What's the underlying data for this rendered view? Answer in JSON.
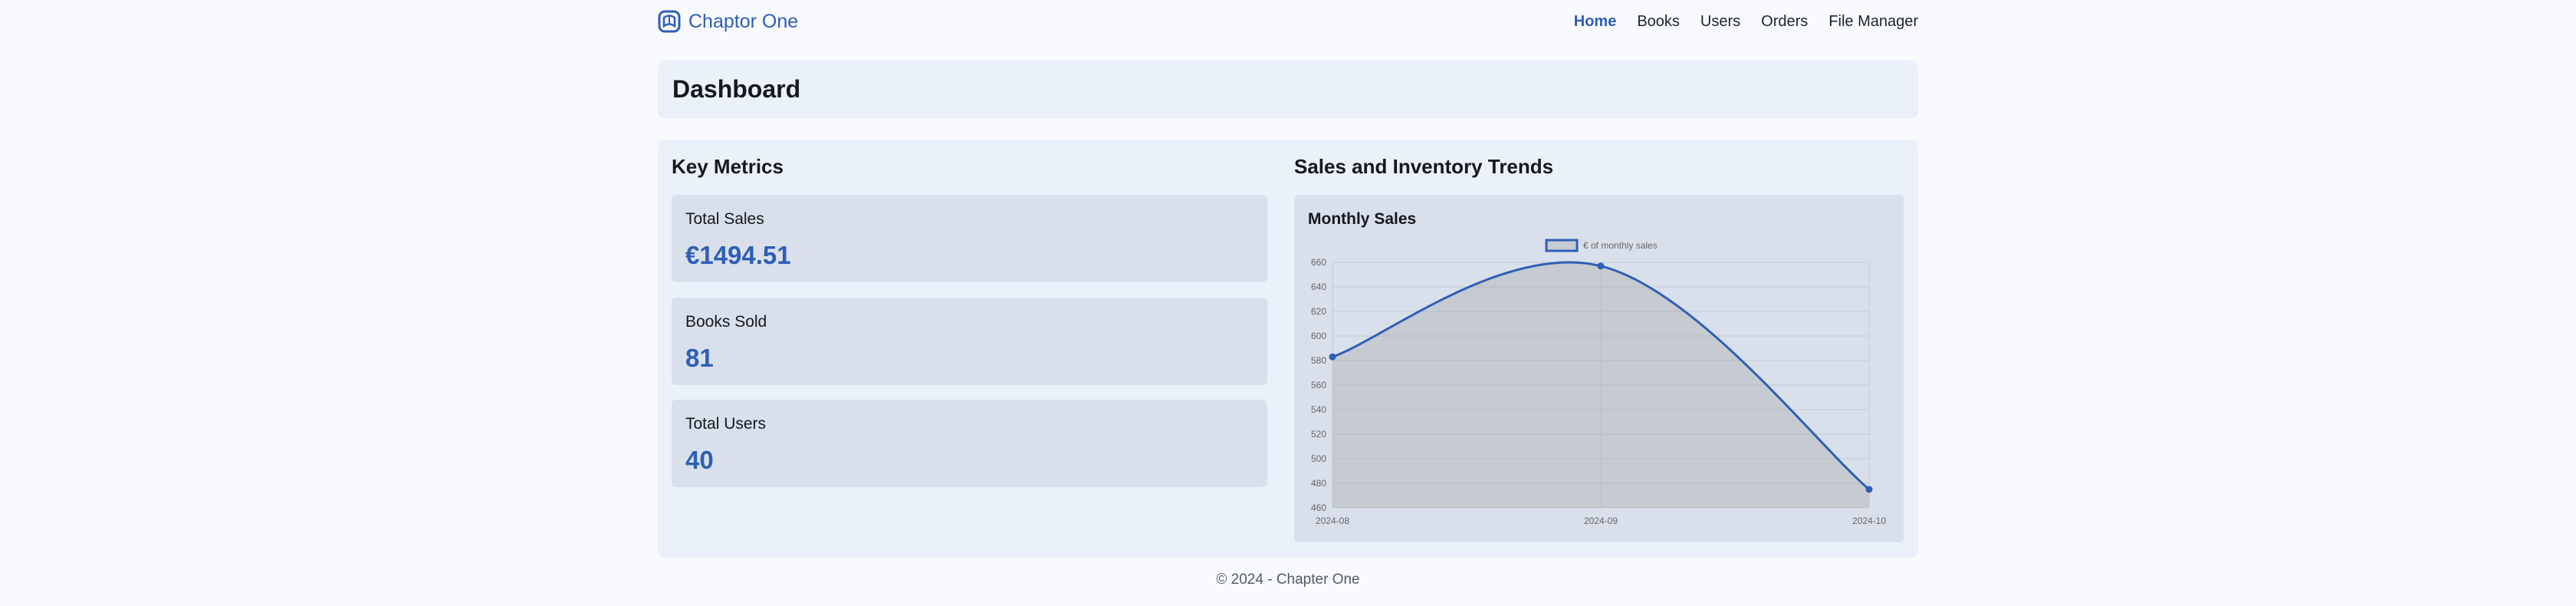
{
  "brand": {
    "name": "Chaptor One",
    "logo_icon": "book-logo-icon"
  },
  "nav": {
    "items": [
      {
        "label": "Home",
        "active": true
      },
      {
        "label": "Books",
        "active": false
      },
      {
        "label": "Users",
        "active": false
      },
      {
        "label": "Orders",
        "active": false
      },
      {
        "label": "File Manager",
        "active": false
      }
    ]
  },
  "page": {
    "title": "Dashboard"
  },
  "metrics": {
    "title": "Key Metrics",
    "cards": [
      {
        "label": "Total Sales",
        "value": "€1494.51"
      },
      {
        "label": "Books Sold",
        "value": "81"
      },
      {
        "label": "Total Users",
        "value": "40"
      }
    ]
  },
  "trends": {
    "title": "Sales and Inventory Trends"
  },
  "chart_data": {
    "type": "line",
    "title": "Monthly Sales",
    "x": [
      "2024-08",
      "2024-09",
      "2024-10"
    ],
    "series": [
      {
        "name": "€ of monthly sales",
        "values": [
          583,
          657,
          475
        ]
      }
    ],
    "ylim": [
      460,
      660
    ],
    "yticks": [
      460,
      480,
      500,
      520,
      540,
      560,
      580,
      600,
      620,
      640,
      660
    ],
    "xlabel": "",
    "ylabel": "",
    "grid": true,
    "legend": "top-center",
    "fill": true,
    "colors": {
      "line": "#2f5fb5",
      "fill": "rgba(160,160,160,0.32)",
      "grid": "#c3cad6"
    }
  },
  "footer": {
    "text": "© 2024 - Chapter One"
  },
  "colors": {
    "accent": "#2f5fb5",
    "panel": "#ebf1fa",
    "card": "#d9e0eb",
    "background": "#f8fafd"
  }
}
